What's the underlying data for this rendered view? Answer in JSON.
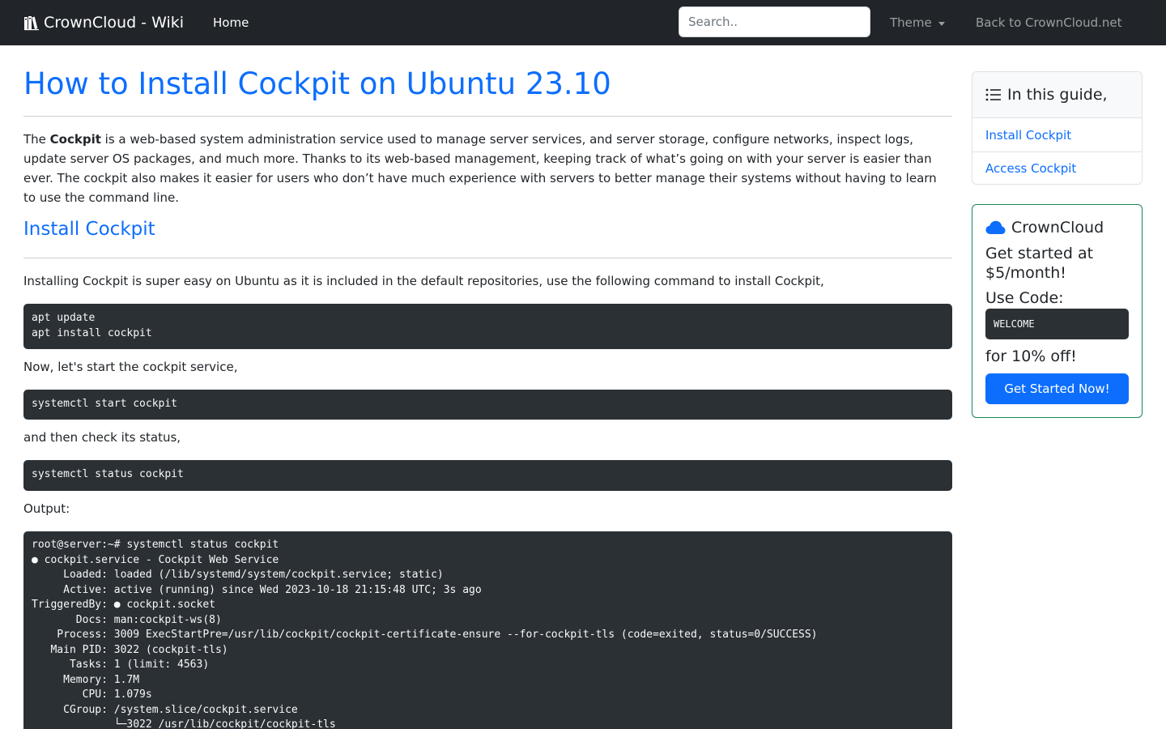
{
  "navbar": {
    "brand": "CrownCloud - Wiki",
    "home": "Home",
    "search_placeholder": "Search..",
    "theme": "Theme",
    "back": "Back to CrownCloud.net"
  },
  "article": {
    "title": "How to Install Cockpit on Ubuntu 23.10",
    "intro_lead": "The ",
    "intro_bold": "Cockpit",
    "intro_rest": " is a web-based system administration service used to manage server services, and server storage, configure networks, inspect logs, update server OS packages, and much more. Thanks to its web-based management, keeping track of what’s going on with your server is easier than ever. The cockpit also makes it easier for users who don’t have much experience with servers to better manage their systems without having to learn to use the command line.",
    "section_install": "Install Cockpit",
    "install_text": "Installing Cockpit is super easy on Ubuntu as it is included in the default repositories, use the following command to install Cockpit,",
    "code_install": "apt update\napt install cockpit",
    "start_text": "Now, let's start the cockpit service,",
    "code_start": "systemctl start cockpit",
    "status_text": "and then check its status,",
    "code_status": "systemctl status cockpit",
    "output_label": "Output:",
    "code_output": "root@server:~# systemctl status cockpit\n● cockpit.service - Cockpit Web Service\n     Loaded: loaded (/lib/systemd/system/cockpit.service; static)\n     Active: active (running) since Wed 2023-10-18 21:15:48 UTC; 3s ago\nTriggeredBy: ● cockpit.socket\n       Docs: man:cockpit-ws(8)\n    Process: 3009 ExecStartPre=/usr/lib/cockpit/cockpit-certificate-ensure --for-cockpit-tls (code=exited, status=0/SUCCESS)\n   Main PID: 3022 (cockpit-tls)\n      Tasks: 1 (limit: 4563)\n     Memory: 1.7M\n        CPU: 1.079s\n     CGroup: /system.slice/cockpit.service\n             └─3022 /usr/lib/cockpit/cockpit-tls"
  },
  "toc": {
    "header": "In this guide,",
    "items": [
      "Install Cockpit",
      "Access Cockpit"
    ]
  },
  "promo": {
    "brand": "CrownCloud",
    "price": "Get started at $5/month!",
    "code_label": "Use Code:",
    "code": "WELCOME",
    "off": "for 10% off!",
    "button": "Get Started Now!"
  },
  "colors": {
    "accent": "#0d6efd",
    "navbar": "#212529",
    "code_bg": "#2b3035",
    "promo_border": "#198754"
  },
  "icons": {
    "brand": "books-icon",
    "toc": "list-icon",
    "promo": "cloud-icon"
  }
}
